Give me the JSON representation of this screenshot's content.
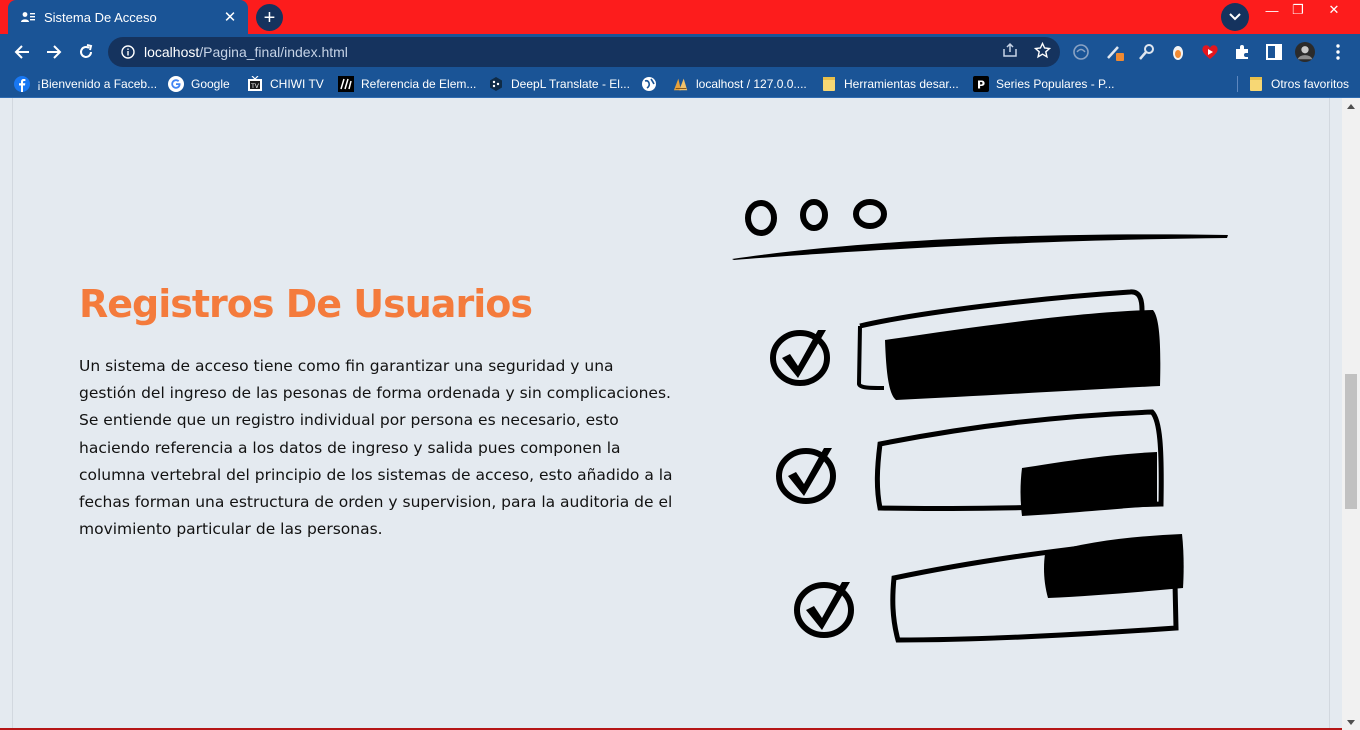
{
  "browser": {
    "tab": {
      "title": "Sistema De Acceso"
    },
    "address": {
      "host": "localhost",
      "path": "/Pagina_final/index.html"
    },
    "colors": {
      "tabstrip": "#fd1c1c",
      "toolbar": "#1a5496",
      "omnibox": "#15335e"
    }
  },
  "bookmarks": {
    "items": [
      {
        "label": "¡Bienvenido a Faceb...",
        "icon": "facebook-icon"
      },
      {
        "label": "Google",
        "icon": "google-icon"
      },
      {
        "label": "CHIWI TV",
        "icon": "tv-icon"
      },
      {
        "label": "Referencia de Elem...",
        "icon": "mdn-icon"
      },
      {
        "label": "DeepL Translate - El...",
        "icon": "deepl-icon"
      },
      {
        "label": "",
        "icon": "globe-icon"
      },
      {
        "label": "localhost / 127.0.0....",
        "icon": "phpmyadmin-icon"
      },
      {
        "label": "Herramientas desar...",
        "icon": "folder-icon"
      },
      {
        "label": "Series Populares - P...",
        "icon": "p-icon"
      }
    ],
    "other": {
      "label": "Otros favoritos",
      "icon": "folder-icon"
    }
  },
  "page": {
    "heading": "Registros De Usuarios",
    "paragraph": "Un sistema de acceso tiene como fin garantizar una seguridad y una gestión del ingreso de las pesonas de forma ordenada y sin complicaciones. Se entiende que un registro individual por persona es necesario, esto haciendo referencia a los datos de ingreso y salida pues componen la columna vertebral del principio de los sistemas de acceso, esto añadido a la fechas forman una estructura de orden y supervision, para la auditoria de el movimiento particular de las personas.",
    "colors": {
      "heading": "#f47b3c",
      "background": "#e4eaf0",
      "text": "#121212"
    },
    "illustration": {
      "icon": "checklist-illustration",
      "rows": 3
    }
  }
}
